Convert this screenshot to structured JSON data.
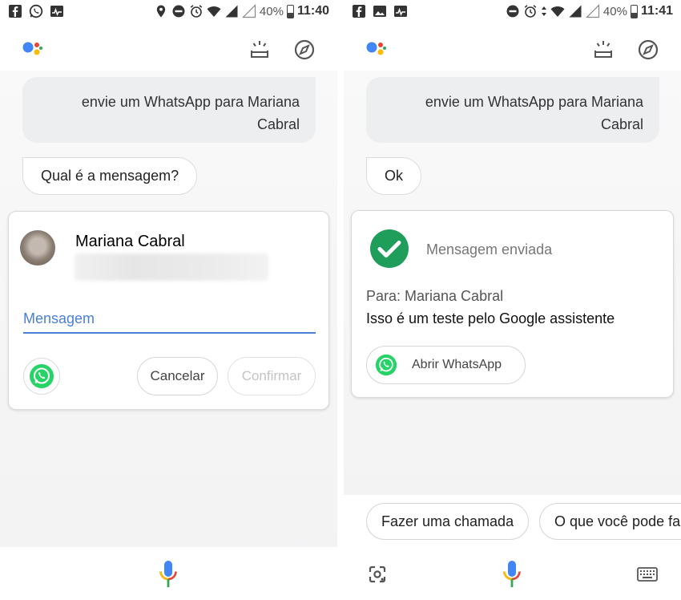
{
  "left": {
    "status": {
      "time": "11:40",
      "battery": "40%"
    },
    "user_query": "envie um WhatsApp para Mariana Cabral",
    "assistant_reply": "Qual é a mensagem?",
    "compose_card": {
      "contact_name": "Mariana Cabral",
      "message_placeholder": "Mensagem",
      "cancel_label": "Cancelar",
      "confirm_label": "Confirmar"
    }
  },
  "right": {
    "status": {
      "time": "11:41",
      "battery": "40%"
    },
    "user_query": "envie um WhatsApp para Mariana Cabral",
    "assistant_reply": "Ok",
    "sent_card": {
      "status_label": "Mensagem enviada",
      "to_line": "Para: Mariana Cabral",
      "message_text": "Isso é um teste pelo Google assistente",
      "open_app_label": "Abrir WhatsApp"
    },
    "suggestions": [
      "Fazer uma chamada",
      "O que você pode fa"
    ]
  },
  "colors": {
    "accent_blue": "#4a7fd8",
    "whatsapp_green": "#25d366",
    "success_green": "#1e9e5a",
    "bubble_gray": "#eceef0"
  },
  "icons": {
    "status_left": [
      "facebook-icon",
      "whatsapp-icon",
      "activity-icon"
    ],
    "status_right": [
      "location-icon",
      "do-not-disturb-icon",
      "alarm-icon",
      "wifi-icon",
      "signal-icon",
      "battery-icon"
    ],
    "top_bar": [
      "google-assistant-logo",
      "snapshot-icon",
      "explore-icon"
    ],
    "bottom_bar": [
      "lens-icon",
      "mic-icon",
      "keyboard-icon"
    ]
  }
}
